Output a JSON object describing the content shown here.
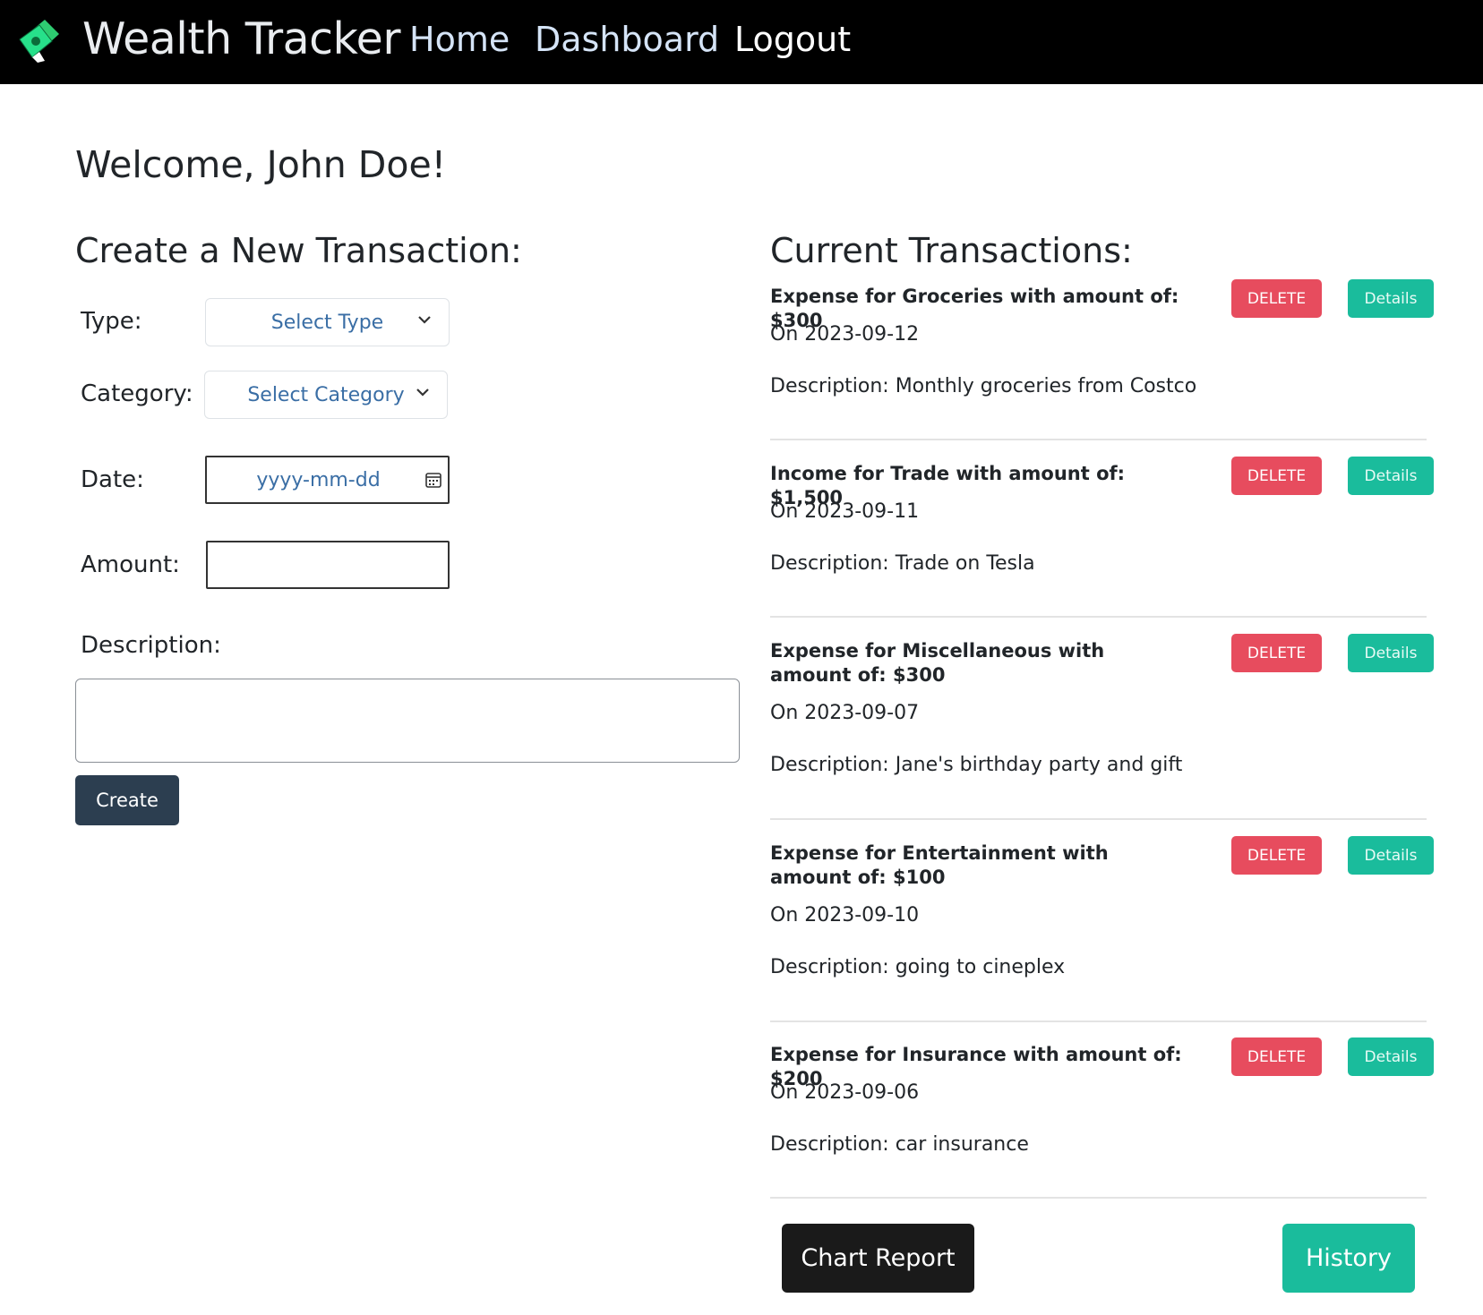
{
  "navbar": {
    "brand": "Wealth Tracker",
    "logo_icon": "money-bill-icon",
    "links": [
      "Home",
      "Dashboard",
      "Logout"
    ]
  },
  "welcome": "Welcome, John Doe!",
  "create_form": {
    "title": "Create a New Transaction:",
    "type_label": "Type:",
    "type_value": "Select Type",
    "category_label": "Category:",
    "category_value": "Select Category",
    "date_label": "Date:",
    "date_placeholder": "yyyy-mm-dd",
    "amount_label": "Amount:",
    "amount_value": "",
    "description_label": "Description:",
    "description_value": "",
    "create_button": "Create"
  },
  "transactions": {
    "title": "Current Transactions:",
    "delete_label": "DELETE",
    "details_label": "Details",
    "items": [
      {
        "heading": "Expense for Groceries with amount of: $300",
        "date": "On 2023-09-12",
        "description": "Description: Monthly groceries from Costco"
      },
      {
        "heading": "Income for Trade with amount of: $1,500",
        "date": "On 2023-09-11",
        "description": "Description: Trade on Tesla"
      },
      {
        "heading": "Expense for Miscellaneous with amount of: $300",
        "date": "On 2023-09-07",
        "description": "Description: Jane's birthday party and gift"
      },
      {
        "heading": "Expense for Entertainment with amount of: $100",
        "date": "On 2023-09-10",
        "description": "Description: going to cineplex"
      },
      {
        "heading": "Expense for Insurance with amount of: $200",
        "date": "On 2023-09-06",
        "description": "Description: car insurance"
      }
    ]
  },
  "footer_buttons": {
    "chart_report": "Chart Report",
    "history": "History"
  },
  "colors": {
    "navbar_bg": "#000000",
    "delete": "#e74c5e",
    "details": "#1abc9c",
    "create": "#2c3e50",
    "chart_report": "#1a1a1a",
    "history": "#1abc9c"
  }
}
